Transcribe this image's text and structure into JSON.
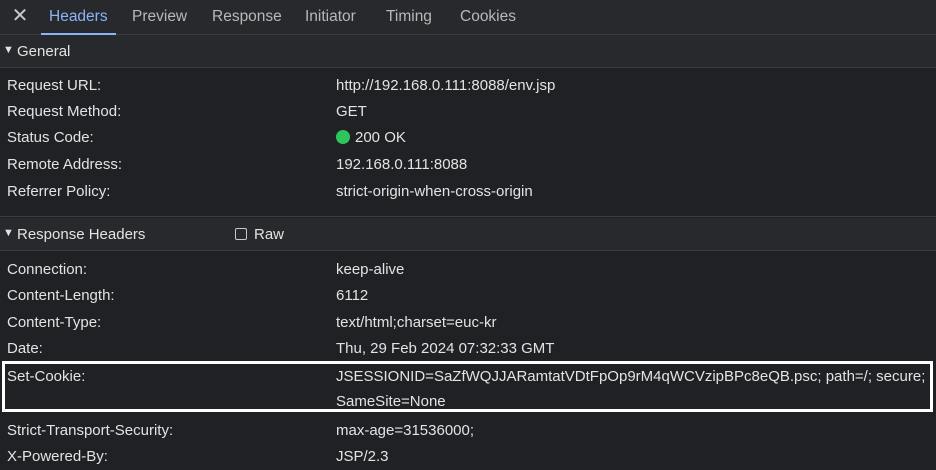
{
  "tabs": {
    "close_glyph": "✕",
    "items": [
      "Headers",
      "Preview",
      "Response",
      "Initiator",
      "Timing",
      "Cookies"
    ],
    "active": "Headers",
    "accent_color": "#8ab4f8"
  },
  "general": {
    "toggle": "▼",
    "title": "General",
    "rows": [
      {
        "key": "Request URL:",
        "value": "http://192.168.0.111:8088/env.jsp"
      },
      {
        "key": "Request Method:",
        "value": "GET"
      },
      {
        "key": "Status Code:",
        "value": "200 OK"
      },
      {
        "key": "Remote Address:",
        "value": "192.168.0.111:8088"
      },
      {
        "key": "Referrer Policy:",
        "value": "strict-origin-when-cross-origin"
      }
    ],
    "status_color": "#2fc55a"
  },
  "response_headers": {
    "toggle": "▼",
    "title": "Response Headers",
    "raw_label": "Raw",
    "raw_checked": false,
    "rows": [
      {
        "key": "Connection:",
        "value": "keep-alive"
      },
      {
        "key": "Content-Length:",
        "value": "6112"
      },
      {
        "key": "Content-Type:",
        "value": "text/html;charset=euc-kr"
      },
      {
        "key": "Date:",
        "value": "Thu, 29 Feb 2024 07:32:33 GMT"
      },
      {
        "key": "Set-Cookie:",
        "value": "JSESSIONID=SaZfWQJJARamtatVDtFpOp9rM4qWCVzipBPc8eQB.psc; path=/; secure;",
        "value_line2": "SameSite=None"
      },
      {
        "key": "Strict-Transport-Security:",
        "value": "max-age=31536000;"
      },
      {
        "key": "X-Powered-By:",
        "value": "JSP/2.3"
      }
    ]
  }
}
